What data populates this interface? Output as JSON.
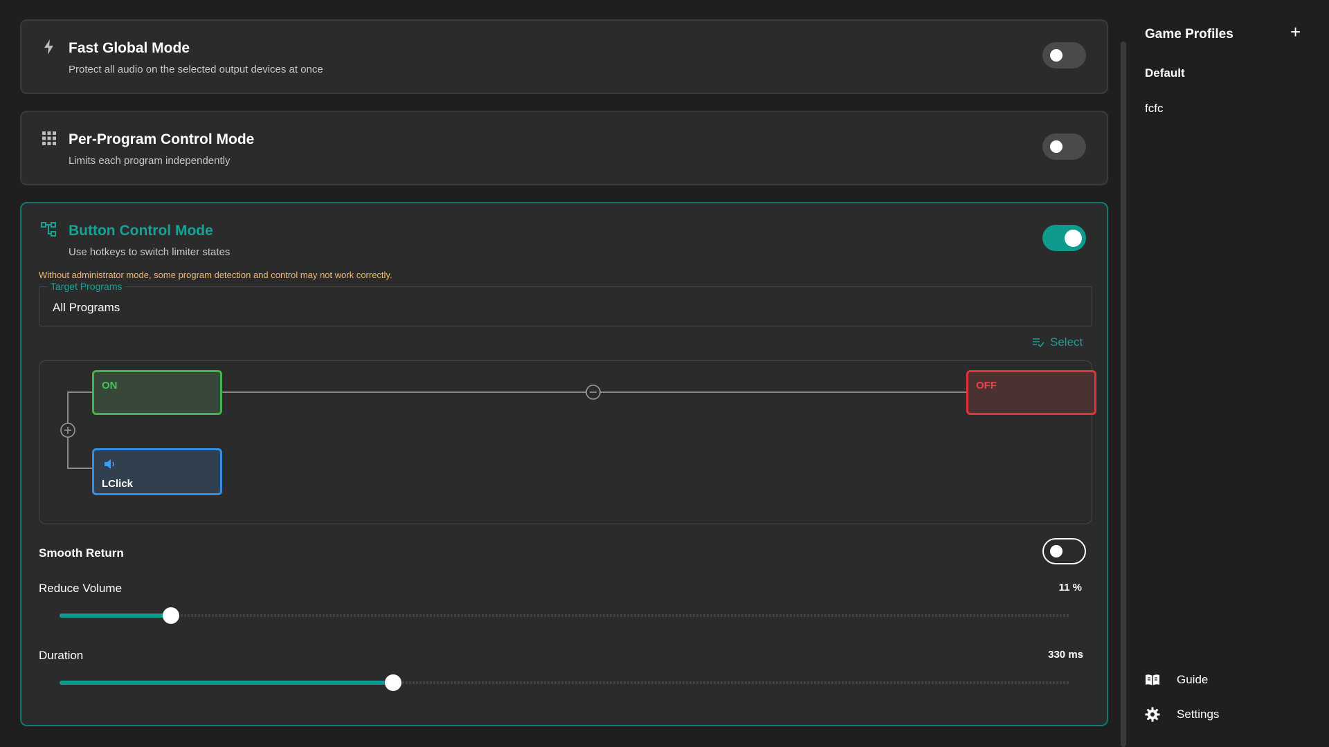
{
  "modes": [
    {
      "title": "Fast Global Mode",
      "subtitle": "Protect all audio on the selected output devices at once",
      "icon": "lightning-icon",
      "enabled": false
    },
    {
      "title": "Per-Program Control Mode",
      "subtitle": "Limits each program independently",
      "icon": "grid-icon",
      "enabled": false
    },
    {
      "title": "Button Control Mode",
      "subtitle": "Use hotkeys to switch limiter states",
      "icon": "nodes-icon",
      "enabled": true
    }
  ],
  "button_mode": {
    "warning": "Without administrator mode, some program detection and control may not work correctly.",
    "target_legend": "Target Programs",
    "target_value": "All Programs",
    "select_label": "Select",
    "flow": {
      "on_label": "ON",
      "off_label": "OFF",
      "key_label": "LClick",
      "add_icon": "plus-circle-icon",
      "remove_icon": "minus-circle-icon",
      "key_icon": "speaker-icon"
    },
    "smooth_return": {
      "label": "Smooth Return",
      "enabled": false
    },
    "reduce_volume": {
      "label": "Reduce Volume",
      "value_text": "11 %",
      "fraction": 0.11
    },
    "duration": {
      "label": "Duration",
      "value_text": "330 ms",
      "fraction": 0.33
    }
  },
  "sidebar": {
    "title": "Game Profiles",
    "add_icon": "plus-icon",
    "profiles": [
      "Default",
      "fcfc"
    ],
    "guide_label": "Guide",
    "settings_label": "Settings"
  },
  "colors": {
    "accent": "#0e9a8c",
    "on_green": "#3fb54d",
    "off_red": "#e2353a",
    "key_blue": "#2f8fe3",
    "warning": "#f2b96a"
  }
}
